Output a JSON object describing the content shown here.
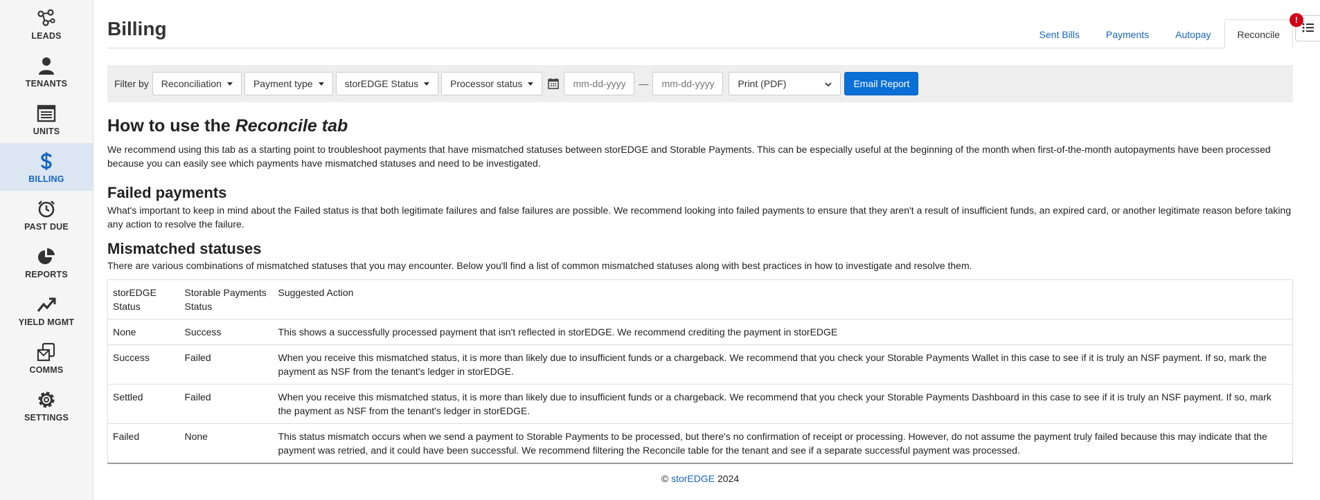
{
  "sidebar": {
    "items": [
      {
        "label": "LEADS",
        "icon": "leads-icon"
      },
      {
        "label": "TENANTS",
        "icon": "user-icon"
      },
      {
        "label": "UNITS",
        "icon": "storage-unit-icon"
      },
      {
        "label": "BILLING",
        "icon": "dollar-icon",
        "active": true
      },
      {
        "label": "PAST DUE",
        "icon": "alarm-clock-icon"
      },
      {
        "label": "REPORTS",
        "icon": "pie-chart-icon"
      },
      {
        "label": "YIELD MGMT",
        "icon": "trend-chart-icon"
      },
      {
        "label": "COMMS",
        "icon": "envelope-icon"
      },
      {
        "label": "SETTINGS",
        "icon": "gear-icon"
      }
    ]
  },
  "header": {
    "title": "Billing",
    "tabs": [
      "Sent Bills",
      "Payments",
      "Autopay",
      "Reconcile"
    ],
    "alert_badge": "!"
  },
  "filters": {
    "label": "Filter by",
    "dropdowns": [
      "Reconciliation",
      "Payment type",
      "storEDGE Status",
      "Processor status"
    ],
    "date_from_placeholder": "mm-dd-yyyy",
    "date_to_placeholder": "mm-dd-yyyy",
    "date_separator": "—",
    "print_value": "Print (PDF)",
    "email_button": "Email Report"
  },
  "content": {
    "heading_prefix": "How to use the ",
    "heading_emphasis": "Reconcile tab",
    "intro": "We recommend using this tab as a starting point to troubleshoot payments that have mismatched statuses between storEDGE and Storable Payments. This can be especially useful at the beginning of the month when first-of-the-month autopayments have been processed because you can easily see which payments have mismatched statuses and need to be investigated.",
    "failed_heading": "Failed payments",
    "failed_text": "What's important to keep in mind about the Failed status is that both legitimate failures and false failures are possible. We recommend looking into failed payments to ensure that they aren't a result of insufficient funds, an expired card, or another legitimate reason before taking any action to resolve the failure.",
    "mismatch_heading": "Mismatched statuses",
    "mismatch_text": "There are various combinations of mismatched statuses that you may encounter. Below you'll find a list of common mismatched statuses along with best practices in how to investigate and resolve them."
  },
  "table": {
    "headers": [
      "storEDGE Status",
      "Storable Payments Status",
      "Suggested Action"
    ],
    "rows": [
      [
        "None",
        "Success",
        "This shows a successfully processed payment that isn't reflected in storEDGE. We recommend crediting the payment in storEDGE"
      ],
      [
        "Success",
        "Failed",
        "When you receive this mismatched status, it is more than likely due to insufficient funds or a chargeback. We recommend that you check your Storable Payments Wallet in this case to see if it is truly an NSF payment. If so, mark the payment as NSF from the tenant's ledger in storEDGE."
      ],
      [
        "Settled",
        "Failed",
        "When you receive this mismatched status, it is more than likely due to insufficient funds or a chargeback. We recommend that you check your Storable Payments Dashboard in this case to see if it is truly an NSF payment. If so, mark the payment as NSF from the tenant's ledger in storEDGE."
      ],
      [
        "Failed",
        "None",
        "This status mismatch occurs when we send a payment to Storable Payments to be processed, but there's no confirmation of receipt or processing. However, do not assume the payment truly failed because this may indicate that the payment was retried, and it could have been successful. We recommend filtering the Reconcile table for the tenant and see if a separate successful payment was processed."
      ]
    ]
  },
  "footer": {
    "copyright": "©",
    "brand": "storEDGE",
    "year": "2024"
  },
  "colors": {
    "accent": "#1565c0",
    "primary_button": "#0a6fd6",
    "active_nav_bg": "#dbe6f2",
    "badge": "#d3001a"
  }
}
